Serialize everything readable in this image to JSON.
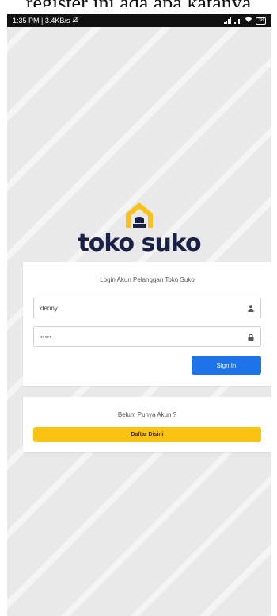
{
  "caption": "register ini ada apa katanya",
  "status_bar": {
    "time_speed": "1:35 PM | 3.4KB/s",
    "mute_icon": "bell-off-icon",
    "battery": "38"
  },
  "logo": {
    "icon": "house-icon",
    "brand": "toko suko",
    "colors": {
      "house": "#f8c21a",
      "brand_text": "#1a2147"
    }
  },
  "login": {
    "title": "Login Akun Pelanggan Toko Suko",
    "username_value": "denny",
    "username_icon": "user-icon",
    "password_value": "•••••",
    "password_icon": "lock-icon",
    "signin_label": "Sign In",
    "signin_color": "#1e73e8"
  },
  "register": {
    "prompt": "Belum Punya Akun ?",
    "button_label": "Daftar Disini",
    "button_color": "#fac312"
  }
}
